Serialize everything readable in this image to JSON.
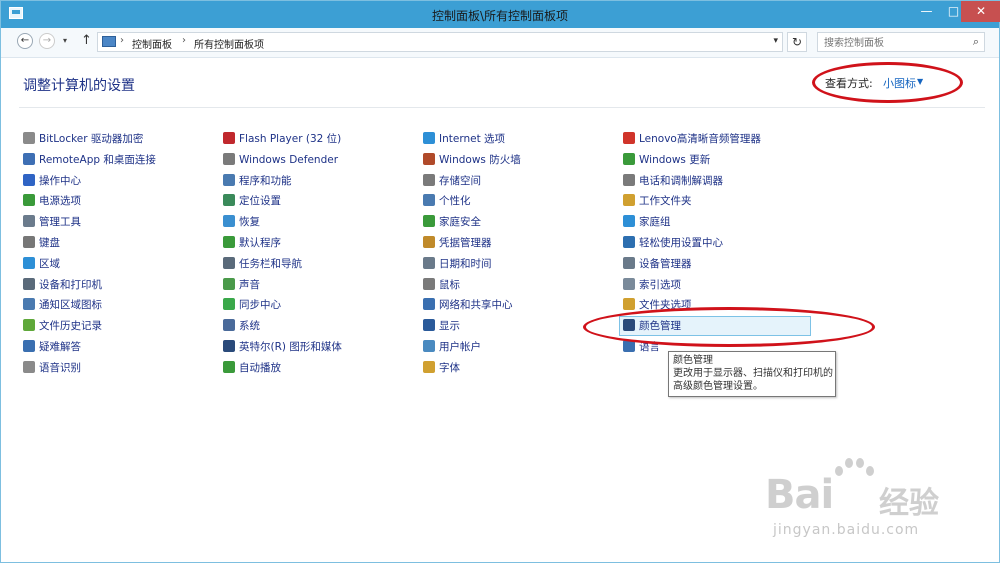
{
  "window": {
    "title": "控制面板\\所有控制面板项",
    "minimize_glyph": "—",
    "maximize_glyph": "□",
    "close_glyph": "✕"
  },
  "address_bar": {
    "back_glyph": "←",
    "forward_glyph": "→",
    "recent_glyph": "▾",
    "up_glyph": "↑",
    "separator": "›",
    "breadcrumbs": [
      "控制面板",
      "所有控制面板项"
    ],
    "dropdown_glyph": "▾",
    "refresh_glyph": "↻",
    "search_placeholder": "搜索控制面板",
    "search_glyph": "⌕"
  },
  "header": {
    "title": "调整计算机的设置",
    "view_by_label": "查看方式:",
    "view_by_value": "小图标",
    "view_by_caret": "▼"
  },
  "columns": [
    [
      {
        "label": "BitLocker 驱动器加密",
        "icon": "bitlocker-icon",
        "color": "#8a8a8a"
      },
      {
        "label": "RemoteApp 和桌面连接",
        "icon": "remoteapp-icon",
        "color": "#3e6fb4"
      },
      {
        "label": "操作中心",
        "icon": "action-center-flag-icon",
        "color": "#2f64c4"
      },
      {
        "label": "电源选项",
        "icon": "power-options-icon",
        "color": "#3a9a3a"
      },
      {
        "label": "管理工具",
        "icon": "admin-tools-icon",
        "color": "#6b7b8c"
      },
      {
        "label": "键盘",
        "icon": "keyboard-icon",
        "color": "#777777"
      },
      {
        "label": "区域",
        "icon": "region-globe-icon",
        "color": "#2d8fd6"
      },
      {
        "label": "设备和打印机",
        "icon": "devices-printers-icon",
        "color": "#5a6a7a"
      },
      {
        "label": "通知区域图标",
        "icon": "notification-area-icon",
        "color": "#4a7ab0"
      },
      {
        "label": "文件历史记录",
        "icon": "file-history-icon",
        "color": "#5fa83a"
      },
      {
        "label": "疑难解答",
        "icon": "troubleshooting-icon",
        "color": "#3a6fb0"
      },
      {
        "label": "语音识别",
        "icon": "speech-recognition-icon",
        "color": "#8a8a8a"
      }
    ],
    [
      {
        "label": "Flash Player (32 位)",
        "icon": "flash-player-icon",
        "color": "#c0282d"
      },
      {
        "label": "Windows Defender",
        "icon": "windows-defender-icon",
        "color": "#7a7a7a"
      },
      {
        "label": "程序和功能",
        "icon": "programs-features-icon",
        "color": "#4a7ab0"
      },
      {
        "label": "定位设置",
        "icon": "location-settings-icon",
        "color": "#3a8a5a"
      },
      {
        "label": "恢复",
        "icon": "recovery-icon",
        "color": "#3a8fd0"
      },
      {
        "label": "默认程序",
        "icon": "default-programs-icon",
        "color": "#3a9a3a"
      },
      {
        "label": "任务栏和导航",
        "icon": "taskbar-navigation-icon",
        "color": "#5a6a7a"
      },
      {
        "label": "声音",
        "icon": "sound-icon",
        "color": "#4a9a4a"
      },
      {
        "label": "同步中心",
        "icon": "sync-center-icon",
        "color": "#3aa84a"
      },
      {
        "label": "系统",
        "icon": "system-icon",
        "color": "#4a6a9a"
      },
      {
        "label": "英特尔(R) 图形和媒体",
        "icon": "intel-graphics-icon",
        "color": "#2a4a7a"
      },
      {
        "label": "自动播放",
        "icon": "autoplay-icon",
        "color": "#3a9a3a"
      }
    ],
    [
      {
        "label": "Internet 选项",
        "icon": "internet-options-icon",
        "color": "#2d8fd6"
      },
      {
        "label": "Windows 防火墙",
        "icon": "windows-firewall-icon",
        "color": "#b04a2a"
      },
      {
        "label": "存储空间",
        "icon": "storage-spaces-icon",
        "color": "#7a7a7a"
      },
      {
        "label": "个性化",
        "icon": "personalization-icon",
        "color": "#4a7ab0"
      },
      {
        "label": "家庭安全",
        "icon": "family-safety-icon",
        "color": "#3a9a3a"
      },
      {
        "label": "凭据管理器",
        "icon": "credential-manager-icon",
        "color": "#c08a2a"
      },
      {
        "label": "日期和时间",
        "icon": "date-time-icon",
        "color": "#6a7a8a"
      },
      {
        "label": "鼠标",
        "icon": "mouse-icon",
        "color": "#7a7a7a"
      },
      {
        "label": "网络和共享中心",
        "icon": "network-sharing-icon",
        "color": "#3a6fb0"
      },
      {
        "label": "显示",
        "icon": "display-icon",
        "color": "#2a5a9a"
      },
      {
        "label": "用户帐户",
        "icon": "user-accounts-icon",
        "color": "#4a8ac0"
      },
      {
        "label": "字体",
        "icon": "fonts-icon",
        "color": "#d0a030"
      }
    ],
    [
      {
        "label": "Lenovo高清晰音频管理器",
        "icon": "lenovo-audio-icon",
        "color": "#d0342a"
      },
      {
        "label": "Windows 更新",
        "icon": "windows-update-icon",
        "color": "#3a9a3a"
      },
      {
        "label": "电话和调制解调器",
        "icon": "phone-modem-icon",
        "color": "#7a7a7a"
      },
      {
        "label": "工作文件夹",
        "icon": "work-folders-icon",
        "color": "#d0a030"
      },
      {
        "label": "家庭组",
        "icon": "homegroup-icon",
        "color": "#2d8fd6"
      },
      {
        "label": "轻松使用设置中心",
        "icon": "ease-of-access-icon",
        "color": "#2d6fb0"
      },
      {
        "label": "设备管理器",
        "icon": "device-manager-icon",
        "color": "#6a7a8a"
      },
      {
        "label": "索引选项",
        "icon": "indexing-options-icon",
        "color": "#7a8a9a"
      },
      {
        "label": "文件夹选项",
        "icon": "folder-options-icon",
        "color": "#d0a030"
      },
      {
        "label": "颜色管理",
        "icon": "color-management-icon",
        "color": "#2a4a7a"
      },
      {
        "label": "语言",
        "icon": "language-icon",
        "color": "#3a6fb0"
      }
    ]
  ],
  "selected_item": "颜色管理",
  "tooltip": {
    "title": "颜色管理",
    "line1": "更改用于显示器、扫描仪和打印机的",
    "line2": "高级颜色管理设置。"
  },
  "watermark": {
    "brand": "Bai",
    "brand2": "经验",
    "url": "jingyan.baidu.com"
  },
  "colors": {
    "titlebar": "#3c9fd4",
    "link": "#1e3287",
    "view_by_value": "#1565c0",
    "highlight_oval": "#d0121a",
    "selected_bg": "#e5f3fb"
  }
}
